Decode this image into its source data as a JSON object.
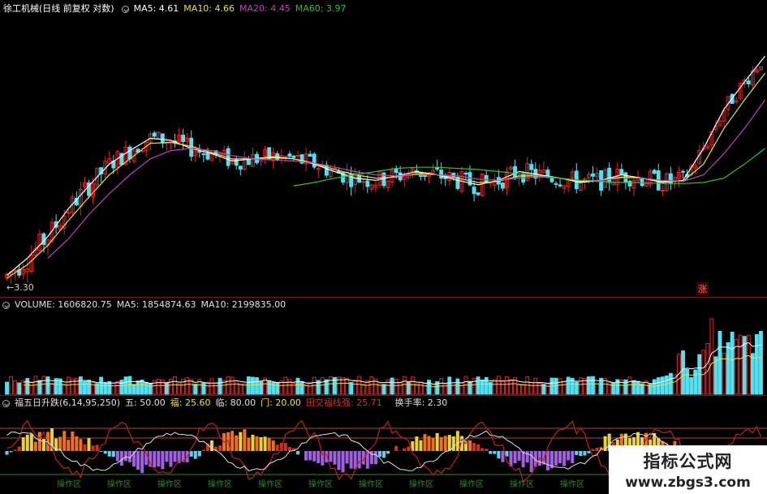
{
  "price_panel": {
    "stock_title": "徐工机械(日线 前复权 对数)",
    "ma_labels": [
      {
        "label": "MA5: 4.61",
        "color": "#ffffff"
      },
      {
        "label": "MA10: 4.66",
        "color": "#e8e23a"
      },
      {
        "label": "MA20: 4.45",
        "color": "#c040c0"
      },
      {
        "label": "MA60: 3.97",
        "color": "#30c030"
      }
    ],
    "low_marker": "←3.30",
    "rise_badge": "涨"
  },
  "volume_panel": {
    "title": "VOLUME: 1606820.75",
    "ma5": "MA5: 1854874.63",
    "ma10": "MA10: 2199835.00"
  },
  "indicator_panel": {
    "title": "福五日升跌(6,14,95,250)",
    "items": [
      {
        "label": "五: 50.00",
        "color": "#e0e0e0"
      },
      {
        "label": "福: 25.60",
        "color": "#e8e23a"
      },
      {
        "label": "临: 80.00",
        "color": "#e0e0e0"
      },
      {
        "label": "门: 20.00",
        "color": "#e8e23a"
      },
      {
        "label": "田交福线强: 25.71",
        "color": "#d03030"
      },
      {
        "label": "换手率: 2.30",
        "color": "#e0e0e0"
      }
    ],
    "op_label": "操作区"
  },
  "watermark": {
    "title": "指标公式网",
    "url": "www.zbgs3.com"
  },
  "colors": {
    "up": "#e02424",
    "down": "#54e0f0",
    "ma5": "#ffffff",
    "ma10": "#e8e23a",
    "ma20": "#c040c0",
    "ma60": "#30c030",
    "bg": "#000000"
  },
  "chart_data": [
    {
      "type": "line",
      "name": "price-candlestick",
      "x": [
        0,
        5,
        10,
        15,
        20,
        25,
        30,
        35,
        40,
        45,
        50,
        55,
        60,
        65,
        70,
        75,
        80,
        85,
        90,
        95,
        100,
        105,
        110,
        115,
        120,
        125,
        130,
        135,
        140,
        145,
        150,
        155,
        160,
        165,
        170,
        175,
        180,
        185
      ],
      "series": [
        {
          "name": "MA5",
          "values": [
            3.32,
            3.45,
            3.62,
            3.85,
            4.05,
            4.25,
            4.38,
            4.5,
            4.48,
            4.4,
            4.35,
            4.28,
            4.3,
            4.32,
            4.3,
            4.25,
            4.18,
            4.12,
            4.1,
            4.14,
            4.18,
            4.15,
            4.1,
            4.06,
            4.1,
            4.18,
            4.15,
            4.12,
            4.08,
            4.1,
            4.15,
            4.12,
            4.08,
            4.1,
            4.4,
            4.8,
            5.1,
            5.4
          ]
        },
        {
          "name": "MA10",
          "values": [
            3.3,
            3.4,
            3.55,
            3.75,
            3.95,
            4.15,
            4.3,
            4.45,
            4.46,
            4.42,
            4.36,
            4.3,
            4.3,
            4.31,
            4.3,
            4.26,
            4.2,
            4.15,
            4.12,
            4.13,
            4.16,
            4.15,
            4.12,
            4.08,
            4.09,
            4.14,
            4.14,
            4.12,
            4.09,
            4.1,
            4.13,
            4.12,
            4.09,
            4.09,
            4.25,
            4.6,
            4.9,
            5.2
          ]
        },
        {
          "name": "MA20",
          "values": [
            null,
            null,
            3.45,
            3.6,
            3.8,
            3.98,
            4.15,
            4.3,
            4.38,
            4.4,
            4.38,
            4.33,
            4.3,
            4.29,
            4.28,
            4.26,
            4.22,
            4.18,
            4.15,
            4.14,
            4.15,
            4.15,
            4.14,
            4.11,
            4.1,
            4.12,
            4.13,
            4.12,
            4.1,
            4.1,
            4.12,
            4.12,
            4.1,
            4.09,
            4.15,
            4.35,
            4.6,
            4.9
          ]
        },
        {
          "name": "MA60",
          "values": [
            null,
            null,
            null,
            null,
            null,
            null,
            null,
            null,
            null,
            null,
            null,
            null,
            null,
            null,
            4.05,
            4.08,
            4.12,
            4.15,
            4.18,
            4.21,
            4.22,
            4.22,
            4.21,
            4.2,
            4.18,
            4.16,
            4.14,
            4.12,
            4.1,
            4.09,
            4.08,
            4.08,
            4.07,
            4.07,
            4.08,
            4.12,
            4.25,
            4.4
          ]
        }
      ]
    }
  ]
}
